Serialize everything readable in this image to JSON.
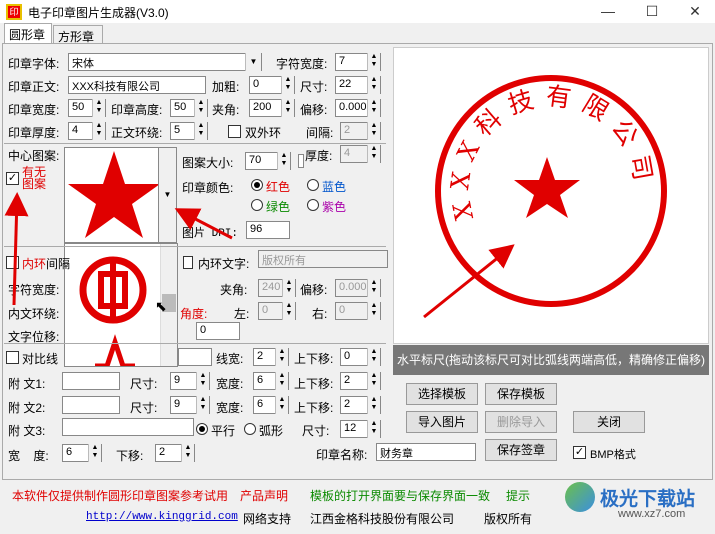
{
  "window": {
    "title": "电子印章图片生成器(V3.0)",
    "min": "—",
    "max": "☐",
    "close": "✕"
  },
  "tabs": [
    {
      "label": "圆形章"
    },
    {
      "label": "方形章"
    }
  ],
  "form": {
    "font_label": "印章字体:",
    "font_value": "宋体",
    "char_width_label": "字符宽度:",
    "char_width_value": "7",
    "body_text_label": "印章正文:",
    "body_text_value": "XXX科技有限公司",
    "bold_label": "加粗:",
    "bold_value": "0",
    "size_label": "尺寸:",
    "size_value": "22",
    "width_label": "印章宽度:",
    "width_value": "50",
    "height_label": "印章高度:",
    "height_value": "50",
    "angle_label": "夹角:",
    "angle_value": "200",
    "offset_label": "偏移:",
    "offset_value": "0.000",
    "thickness_label": "印章厚度:",
    "thickness_value": "4",
    "ring_label": "正文环绕:",
    "ring_value": "5",
    "double_ring_label": "双外环",
    "spacing_label": "间隔:",
    "spacing_value": "2",
    "thickness2_label": "厚度:",
    "thickness2_value": "4",
    "center_pattern_label": "中心图案:",
    "has_pattern_label_1": "有无",
    "has_pattern_label_2": "图案",
    "pattern_size_label": "图案大小:",
    "pattern_size_value": "70",
    "color_label": "印章颜色:",
    "colors": [
      {
        "label": "红色",
        "value": "#e00000"
      },
      {
        "label": "蓝色",
        "value": "#0055cc"
      },
      {
        "label": "绿色",
        "value": "#0a8a00"
      },
      {
        "label": "紫色",
        "value": "#aa00aa"
      }
    ],
    "dpi_label_a": "图",
    "dpi_label_b": "片 DPI:",
    "dpi_value": "96",
    "inner_ring_label": "内环",
    "inner_gap_label": "间隔",
    "inner_text_label": "内环文字:",
    "inner_text_placeholder": "版权所有",
    "inner_char_width_label": "字符宽度:",
    "inner_angle_label": "夹角:",
    "inner_angle_value": "240",
    "inner_offset_label": "偏移:",
    "inner_offset_value": "0.000",
    "inner_wrap_label": "内文环绕:",
    "inner_deg_label": "角度:",
    "inner_left_label": "左:",
    "inner_left_value": "0",
    "inner_right_label": "右:",
    "inner_right_value": "0",
    "text_pos_label": "文字位移:",
    "text_pos_value": "0",
    "compare_label": "对比线",
    "line_width_label": "线宽:",
    "line_width_value": "2",
    "updown_label": "上下移:",
    "updown_value": "0",
    "aux1_label": "附  文1:",
    "aux1_size_label": "尺寸:",
    "aux1_size_value": "9",
    "aux1_width_label": "宽度:",
    "aux1_width_value": "6",
    "aux1_move_label": "上下移:",
    "aux1_move_value": "2",
    "aux2_label": "附  文2:",
    "aux2_size_label": "尺寸:",
    "aux2_size_value": "9",
    "aux2_width_label": "宽度:",
    "aux2_width_value": "6",
    "aux2_move_label": "上下移:",
    "aux2_move_value": "2",
    "aux3_label": "附  文3:",
    "parallel_label": "平行",
    "arc_label": "弧形",
    "aux3_size_label": "尺寸:",
    "aux3_size_value": "12",
    "w_label": "宽    度:",
    "w_value": "6",
    "down_label": "下移:",
    "down_value": "2",
    "seal_name_label": "印章名称:",
    "seal_name_value": "财务章",
    "bmp_label": "BMP格式"
  },
  "buttons": {
    "select_template": "选择模板",
    "save_template": "保存模板",
    "import_image": "导入图片",
    "delete_import": "删除导入",
    "close": "关闭",
    "save_seal": "保存签章"
  },
  "seal_preview": {
    "text": "XXX科技有限公司",
    "color": "#e00000"
  },
  "ruler_text": "水平标尺(拖动该标尺可对比弧线两端高低，精确修正偏移)",
  "footer": {
    "notice": "本软件仅提供制作圆形印章图案参考试用",
    "product": "产品声明",
    "template_tip": "模板的打开界面要与保存界面一致",
    "hint": "提示",
    "url": "http://www.kinggrid.com",
    "support": "网络支持",
    "company": "江西金格科技股份有限公司",
    "rights": "版权所有"
  },
  "watermark": {
    "brand": "极光下载站",
    "site": "www.xz7.com"
  }
}
